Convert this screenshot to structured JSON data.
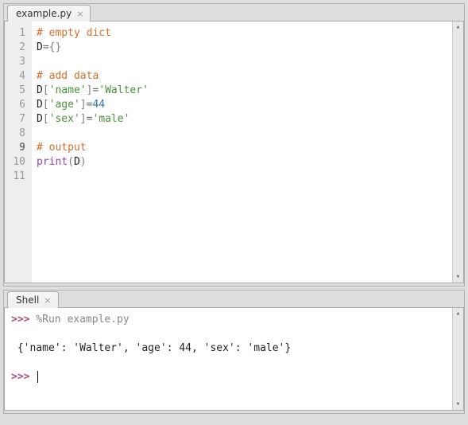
{
  "editor": {
    "tab_label": "example.py",
    "lines": [
      {
        "n": "1",
        "bold": false,
        "tokens": [
          [
            "comment",
            "# empty dict"
          ]
        ]
      },
      {
        "n": "2",
        "bold": false,
        "tokens": [
          [
            "ident",
            "D"
          ],
          [
            "op",
            "="
          ],
          [
            "bracket",
            "{}"
          ]
        ]
      },
      {
        "n": "3",
        "bold": false,
        "tokens": []
      },
      {
        "n": "4",
        "bold": false,
        "tokens": [
          [
            "comment",
            "# add data"
          ]
        ]
      },
      {
        "n": "5",
        "bold": false,
        "tokens": [
          [
            "ident",
            "D"
          ],
          [
            "bracket",
            "["
          ],
          [
            "string",
            "'name'"
          ],
          [
            "bracket",
            "]"
          ],
          [
            "op",
            "="
          ],
          [
            "string",
            "'Walter'"
          ]
        ]
      },
      {
        "n": "6",
        "bold": false,
        "tokens": [
          [
            "ident",
            "D"
          ],
          [
            "bracket",
            "["
          ],
          [
            "string",
            "'age'"
          ],
          [
            "bracket",
            "]"
          ],
          [
            "op",
            "="
          ],
          [
            "number",
            "44"
          ]
        ]
      },
      {
        "n": "7",
        "bold": false,
        "tokens": [
          [
            "ident",
            "D"
          ],
          [
            "bracket",
            "["
          ],
          [
            "string",
            "'sex'"
          ],
          [
            "bracket",
            "]"
          ],
          [
            "op",
            "="
          ],
          [
            "string",
            "'male'"
          ]
        ]
      },
      {
        "n": "8",
        "bold": false,
        "tokens": []
      },
      {
        "n": "9",
        "bold": true,
        "tokens": [
          [
            "comment",
            "# output"
          ]
        ]
      },
      {
        "n": "10",
        "bold": false,
        "tokens": [
          [
            "func",
            "print"
          ],
          [
            "bracket",
            "("
          ],
          [
            "ident",
            "D"
          ],
          [
            "bracket",
            ")"
          ]
        ]
      },
      {
        "n": "11",
        "bold": false,
        "tokens": []
      }
    ]
  },
  "shell": {
    "tab_label": "Shell",
    "prompt": ">>> ",
    "run_cmd": "%Run example.py",
    "output": " {'name': 'Walter', 'age': 44, 'sex': 'male'}"
  }
}
